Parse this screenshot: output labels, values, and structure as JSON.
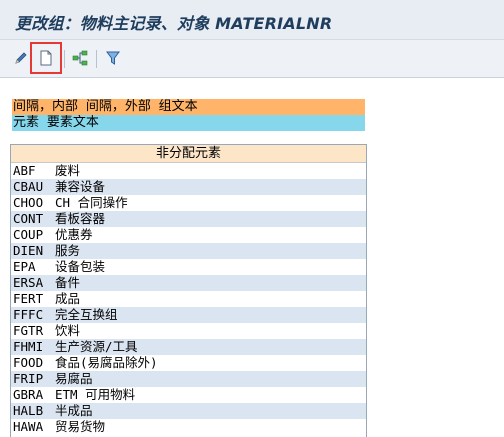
{
  "title": "更改组：物料主记录、对象 MATERIALNR",
  "toolbar": {
    "buttons": [
      {
        "name": "edit-icon"
      },
      {
        "name": "new-document-icon"
      },
      {
        "name": "hierarchy-icon"
      },
      {
        "name": "filter-icon"
      }
    ]
  },
  "legend": {
    "row1": "间隔，内部 间隔，外部 组文本",
    "row2": "元素 要素文本"
  },
  "grid": {
    "header": "非分配元素",
    "rows": [
      {
        "code": "ABF",
        "text": "废料"
      },
      {
        "code": "CBAU",
        "text": "兼容设备"
      },
      {
        "code": "CHOO",
        "text": "CH 合同操作"
      },
      {
        "code": "CONT",
        "text": "看板容器"
      },
      {
        "code": "COUP",
        "text": "优惠券"
      },
      {
        "code": "DIEN",
        "text": "服务"
      },
      {
        "code": "EPA",
        "text": "设备包装"
      },
      {
        "code": "ERSA",
        "text": "备件"
      },
      {
        "code": "FERT",
        "text": "成品"
      },
      {
        "code": "FFFC",
        "text": "完全互换组"
      },
      {
        "code": "FGTR",
        "text": "饮料"
      },
      {
        "code": "FHMI",
        "text": "生产资源/工具"
      },
      {
        "code": "FOOD",
        "text": "食品(易腐品除外)"
      },
      {
        "code": "FRIP",
        "text": "易腐品"
      },
      {
        "code": "GBRA",
        "text": "ETM 可用物料"
      },
      {
        "code": "HALB",
        "text": "半成品"
      },
      {
        "code": "HAWA",
        "text": "贸易货物"
      }
    ]
  }
}
